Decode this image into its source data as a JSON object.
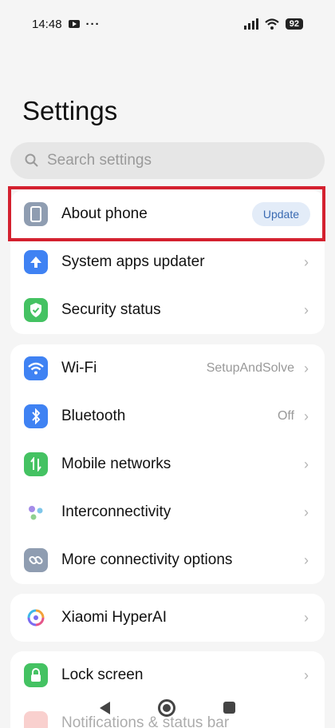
{
  "status_bar": {
    "time": "14:48",
    "dots": "···",
    "battery": "92"
  },
  "page_title": "Settings",
  "search": {
    "placeholder": "Search settings"
  },
  "group1": [
    {
      "label": "About phone",
      "button": "Update",
      "icon": "phone-icon",
      "color": "#8f9db1"
    },
    {
      "label": "System apps updater",
      "icon": "arrow-up-icon",
      "color": "#3f82f3"
    },
    {
      "label": "Security status",
      "icon": "shield-check-icon",
      "color": "#44c262"
    }
  ],
  "group2": [
    {
      "label": "Wi-Fi",
      "value": "SetupAndSolve",
      "icon": "wifi-icon",
      "color": "#3f82f3"
    },
    {
      "label": "Bluetooth",
      "value": "Off",
      "icon": "bluetooth-icon",
      "color": "#3f82f3"
    },
    {
      "label": "Mobile networks",
      "icon": "mobile-data-icon",
      "color": "#44c262"
    },
    {
      "label": "Interconnectivity",
      "icon": "interconnectivity-icon",
      "color": "#ffffff"
    },
    {
      "label": "More connectivity options",
      "icon": "link-icon",
      "color": "#8f9db1"
    }
  ],
  "group3": [
    {
      "label": "Xiaomi HyperAI",
      "icon": "hyperai-icon"
    }
  ],
  "group4": [
    {
      "label": "Lock screen",
      "icon": "lock-icon",
      "color": "#44c262"
    },
    {
      "label": "Notifications & status bar",
      "icon": "notification-icon",
      "color": "#f07a76"
    }
  ],
  "chevron": "›"
}
